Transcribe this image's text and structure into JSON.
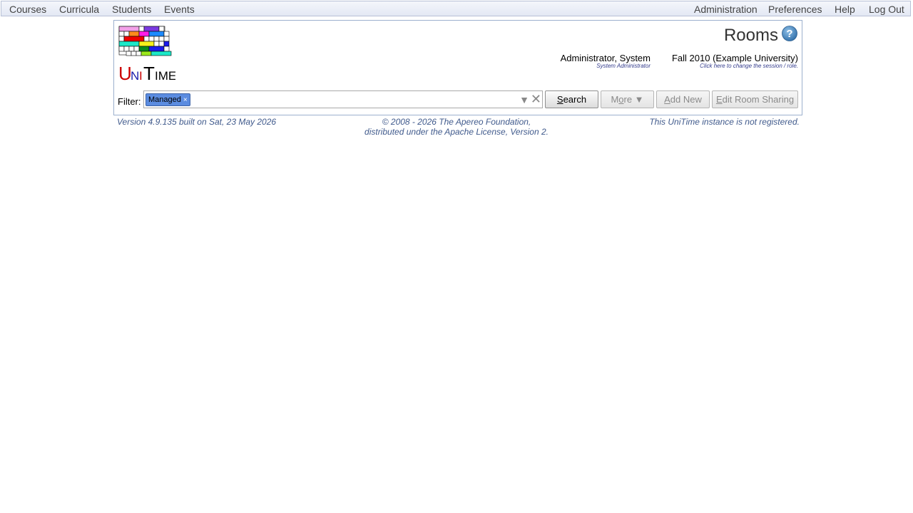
{
  "menubar": {
    "left": [
      "Courses",
      "Curricula",
      "Students",
      "Events"
    ],
    "right": [
      "Administration",
      "Preferences",
      "Help",
      "Log Out"
    ]
  },
  "header": {
    "logo_text": "UniTime",
    "title": "Rooms",
    "help_icon": "question-mark-icon",
    "user": {
      "name": "Administrator, System",
      "role": "System Administrator"
    },
    "session": {
      "name": "Fall 2010 (Example University)",
      "hint": "Click here to change the session / role."
    }
  },
  "filter": {
    "label": "Filter:",
    "chips": [
      "Managed"
    ],
    "value": "",
    "dropdown_icon": "triangle-down-icon",
    "clear_icon": "close-icon"
  },
  "buttons": {
    "search": {
      "prefix": "",
      "accel": "S",
      "rest": "earch"
    },
    "more": {
      "prefix": "M",
      "accel": "o",
      "rest": "re ▼"
    },
    "add_new": {
      "prefix": "",
      "accel": "A",
      "rest": "dd New"
    },
    "edit_room_sharing": {
      "prefix": "",
      "accel": "E",
      "rest": "dit Room Sharing"
    }
  },
  "footer": {
    "version": "Version 4.9.135 built on Sat, 23 May 2026",
    "copyright_line1": "© 2008 - 2026 The Apereo Foundation,",
    "copyright_line2": "distributed under the Apache License, Version 2.",
    "registration": "This UniTime instance is not registered."
  },
  "colors": {
    "accent_text": "#405a8c",
    "chip_bg": "#5b8ce0",
    "logo_u": "#cc0000",
    "logo_n": "#1a1aaa",
    "logo_i": "#cc0000"
  }
}
